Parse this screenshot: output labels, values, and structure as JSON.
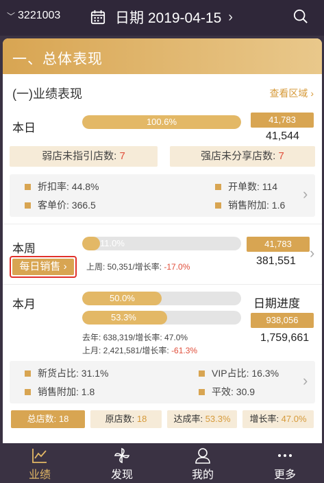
{
  "header": {
    "store_id": "3221003",
    "date_label": "日期 2019-04-15"
  },
  "section": {
    "title": "一、总体表现",
    "perf_title": "(一)业绩表现",
    "view_region": "查看区域"
  },
  "today": {
    "label": "本日",
    "progress_text": "100.6%",
    "progress_value": 100.6,
    "target": "41,783",
    "actual": "41,544",
    "weak_label": "弱店未指引店数: ",
    "weak_value": "7",
    "strong_label": "强店未分享店数: ",
    "strong_value": "7",
    "metrics": [
      {
        "label": "折扣率: 44.8%"
      },
      {
        "label": "开单数: 114"
      },
      {
        "label": "客单价: 366.5"
      },
      {
        "label": "销售附加: 1.6"
      }
    ]
  },
  "week": {
    "label": "本周",
    "progress_text": "11.0%",
    "progress_value": 11.0,
    "target": "41,783",
    "actual": "381,551",
    "daily_sales_button": "每日销售",
    "last_week_prefix": "上周: 50,351/增长率: ",
    "last_week_growth": "-17.0%"
  },
  "month": {
    "label": "本月",
    "progress1_text": "50.0%",
    "progress1_value": 50.0,
    "progress2_text": "53.3%",
    "progress2_value": 53.3,
    "date_progress_label": "日期进度",
    "target": "938,056",
    "actual": "1,759,661",
    "last_year": "去年: 638,319/增长率: 47.0%",
    "last_month_prefix": "上月: 2,421,581/增长率: ",
    "last_month_growth": "-61.3%",
    "metrics": [
      {
        "label": "新货占比: 31.1%"
      },
      {
        "label": "VIP占比: 16.3%"
      },
      {
        "label": "销售附加: 1.8"
      },
      {
        "label": "平效: 30.9"
      }
    ],
    "stats": [
      {
        "label": "总店数: ",
        "value": "18"
      },
      {
        "label": "原店数: ",
        "value": "18"
      },
      {
        "label": "达成率: ",
        "value": "53.3%"
      },
      {
        "label": "增长率: ",
        "value": "47.0%"
      }
    ]
  },
  "nav": [
    {
      "label": "业绩",
      "icon": "chart-line-icon",
      "active": true
    },
    {
      "label": "发现",
      "icon": "pinwheel-icon",
      "active": false
    },
    {
      "label": "我的",
      "icon": "user-icon",
      "active": false
    },
    {
      "label": "更多",
      "icon": "more-dots-icon",
      "active": false
    }
  ],
  "colors": {
    "header_bg": "#2f2739",
    "accent_gold": "#d8a552",
    "bar_gold": "#e3b866",
    "negative_red": "#e04e3a"
  }
}
